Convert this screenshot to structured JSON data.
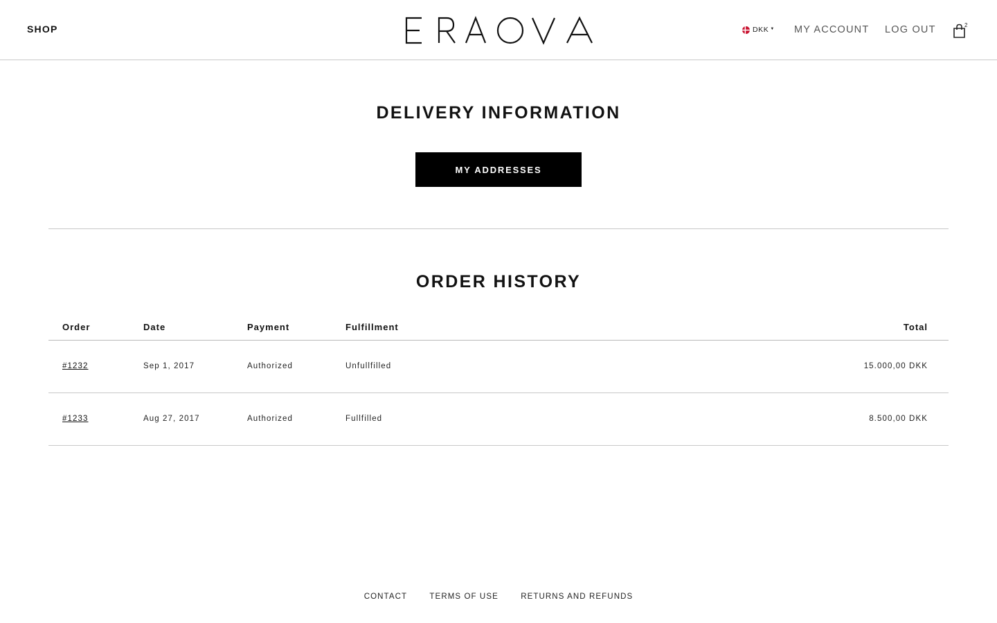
{
  "header": {
    "shop_label": "SHOP",
    "logo_text": "ERAOVA",
    "currency": {
      "code": "DKK",
      "flag_icon": "denmark-flag-icon"
    },
    "nav": {
      "account_label": "MY ACCOUNT",
      "logout_label": "LOG OUT"
    },
    "cart": {
      "count": "2",
      "icon": "shopping-bag-icon"
    }
  },
  "delivery": {
    "title": "DELIVERY INFORMATION",
    "button_label": "MY ADDRESSES"
  },
  "orders": {
    "title": "ORDER HISTORY",
    "columns": {
      "order": "Order",
      "date": "Date",
      "payment": "Payment",
      "fulfillment": "Fulfillment",
      "total": "Total"
    },
    "rows": [
      {
        "order": "#1232",
        "date": "Sep 1, 2017",
        "payment": "Authorized",
        "fulfillment": "Unfullfilled",
        "total": "15.000,00 DKK"
      },
      {
        "order": "#1233",
        "date": "Aug 27, 2017",
        "payment": "Authorized",
        "fulfillment": "Fullfilled",
        "total": "8.500,00 DKK"
      }
    ]
  },
  "footer": {
    "links": [
      "CONTACT",
      "TERMS OF USE",
      "RETURNS AND REFUNDS"
    ]
  },
  "colors": {
    "primary": "#000000",
    "divider": "#c8c8c8",
    "flag_red": "#c8102e"
  }
}
